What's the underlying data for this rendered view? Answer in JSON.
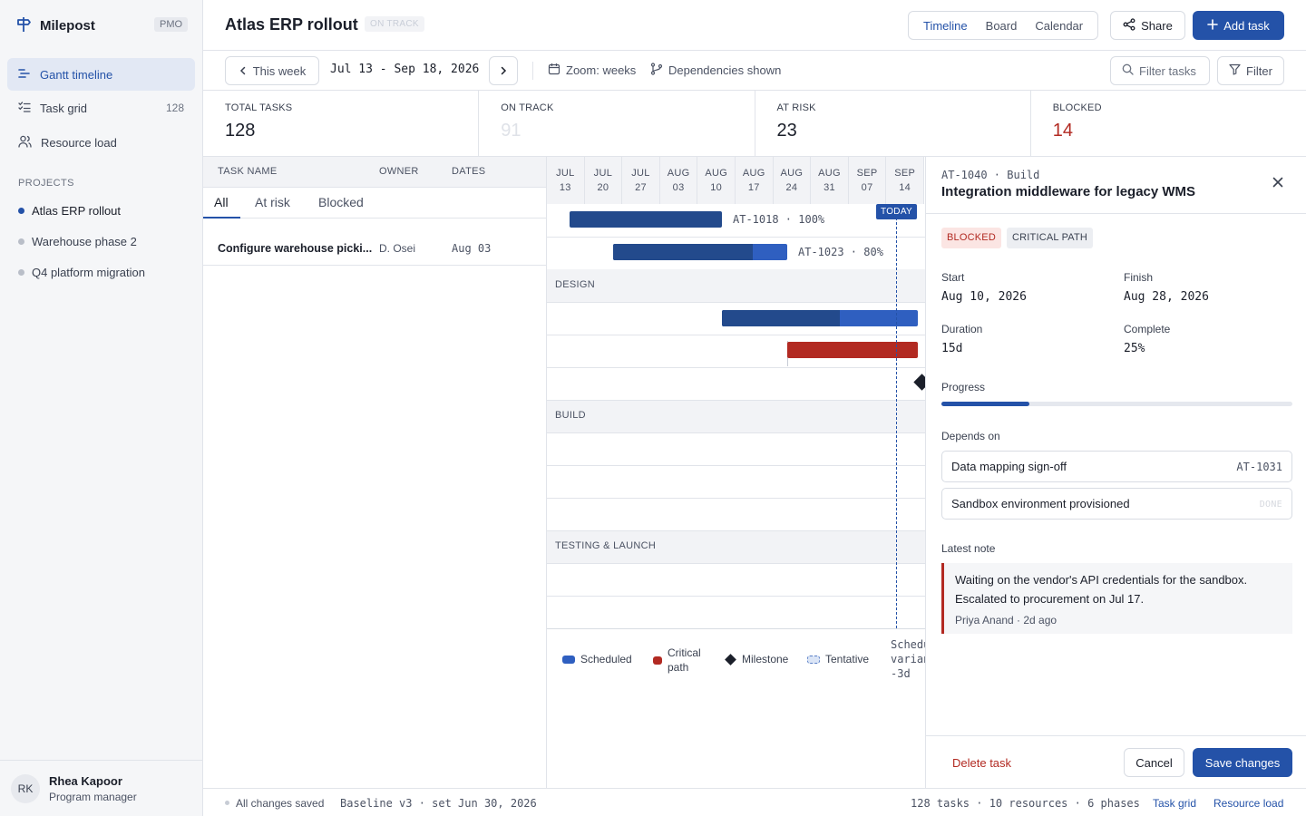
{
  "app": {
    "name": "Milepost",
    "badge": "PMO"
  },
  "sidebar": {
    "nav": [
      {
        "label": "Gantt timeline",
        "icon": "gantt-icon",
        "active": true
      },
      {
        "label": "Task grid",
        "icon": "checklist-icon",
        "count": "128"
      },
      {
        "label": "Resource load",
        "icon": "people-icon"
      }
    ],
    "projects_label": "PROJECTS",
    "projects": [
      {
        "label": "Atlas ERP rollout",
        "active": true
      },
      {
        "label": "Warehouse phase 2"
      },
      {
        "label": "Q4 platform migration"
      }
    ],
    "user": {
      "initials": "RK",
      "name": "Rhea Kapoor",
      "role": "Program manager"
    }
  },
  "header": {
    "title": "Atlas ERP rollout",
    "status": "ON TRACK",
    "views": [
      "Timeline",
      "Board",
      "Calendar"
    ],
    "active_view": "Timeline",
    "share_label": "Share",
    "add_label": "Add task"
  },
  "toolbar": {
    "this_week": "This week",
    "date_range": "Jul 13 - Sep 18, 2026",
    "zoom": "Zoom: weeks",
    "dependencies": "Dependencies shown",
    "filter_placeholder": "Filter tasks",
    "filter_label": "Filter"
  },
  "stats": [
    {
      "label": "TOTAL TASKS",
      "value": "128",
      "color": "#1b1f2a"
    },
    {
      "label": "ON TRACK",
      "value": "91",
      "color": "#dfe2e8"
    },
    {
      "label": "AT RISK",
      "value": "23",
      "color": "#1b1f2a"
    },
    {
      "label": "BLOCKED",
      "value": "14",
      "color": "#b22a22"
    }
  ],
  "tasklist": {
    "columns": [
      "TASK NAME",
      "OWNER",
      "DATES"
    ],
    "tabs": [
      "All",
      "At risk",
      "Blocked"
    ],
    "rows": [
      {
        "name": "Configure warehouse picki...",
        "owner": "D. Osei",
        "date": "Aug 03"
      }
    ]
  },
  "gantt": {
    "weeks": [
      [
        "JUL",
        "13"
      ],
      [
        "JUL",
        "20"
      ],
      [
        "JUL",
        "27"
      ],
      [
        "AUG",
        "03"
      ],
      [
        "AUG",
        "10"
      ],
      [
        "AUG",
        "17"
      ],
      [
        "AUG",
        "24"
      ],
      [
        "AUG",
        "31"
      ],
      [
        "SEP",
        "07"
      ],
      [
        "SEP",
        "14"
      ]
    ],
    "today_label": "TODAY",
    "phases": [
      "DESIGN",
      "BUILD",
      "TESTING & LAUNCH"
    ],
    "bar_labels": [
      "AT-1018 · 100%",
      "AT-1023 · 80%"
    ],
    "legend": {
      "scheduled": "Scheduled",
      "critical": "Critical path",
      "milestone": "Milestone",
      "tentative": "Tentative",
      "variance_l1": "Schedule",
      "variance_l2": "variance",
      "variance_l3": "-3d"
    },
    "colors": {
      "scheduled": "#2452a8",
      "scheduled_dark": "#234a8c",
      "critical": "#b22a22",
      "milestone": "#1b1f2a"
    }
  },
  "detail": {
    "id_line": "AT-1040 · Build",
    "title": "Integration middleware for legacy WMS",
    "chips": [
      "BLOCKED",
      "CRITICAL PATH"
    ],
    "start_label": "Start",
    "start": "Aug 10, 2026",
    "finish_label": "Finish",
    "finish": "Aug 28, 2026",
    "duration_label": "Duration",
    "duration": "15d",
    "complete_label": "Complete",
    "complete": "25%",
    "progress_label": "Progress",
    "progress": 0.25,
    "depends_label": "Depends on",
    "depends": [
      {
        "name": "Data mapping sign-off",
        "ref": "AT-1031"
      },
      {
        "name": "Sandbox environment provisioned",
        "ref": "DONE"
      }
    ],
    "note_label": "Latest note",
    "note_text": "Waiting on the vendor's API credentials for the sandbox. Escalated to procurement on Jul 17.",
    "note_meta": "Priya Anand · 2d ago",
    "delete_label": "Delete task",
    "cancel_label": "Cancel",
    "save_label": "Save changes"
  },
  "statusbar": {
    "saved": "All changes saved",
    "baseline": "Baseline v3 · set Jun 30, 2026",
    "summary": "128 tasks · 10 resources · 6 phases",
    "link1": "Task grid",
    "link2": "Resource load"
  }
}
